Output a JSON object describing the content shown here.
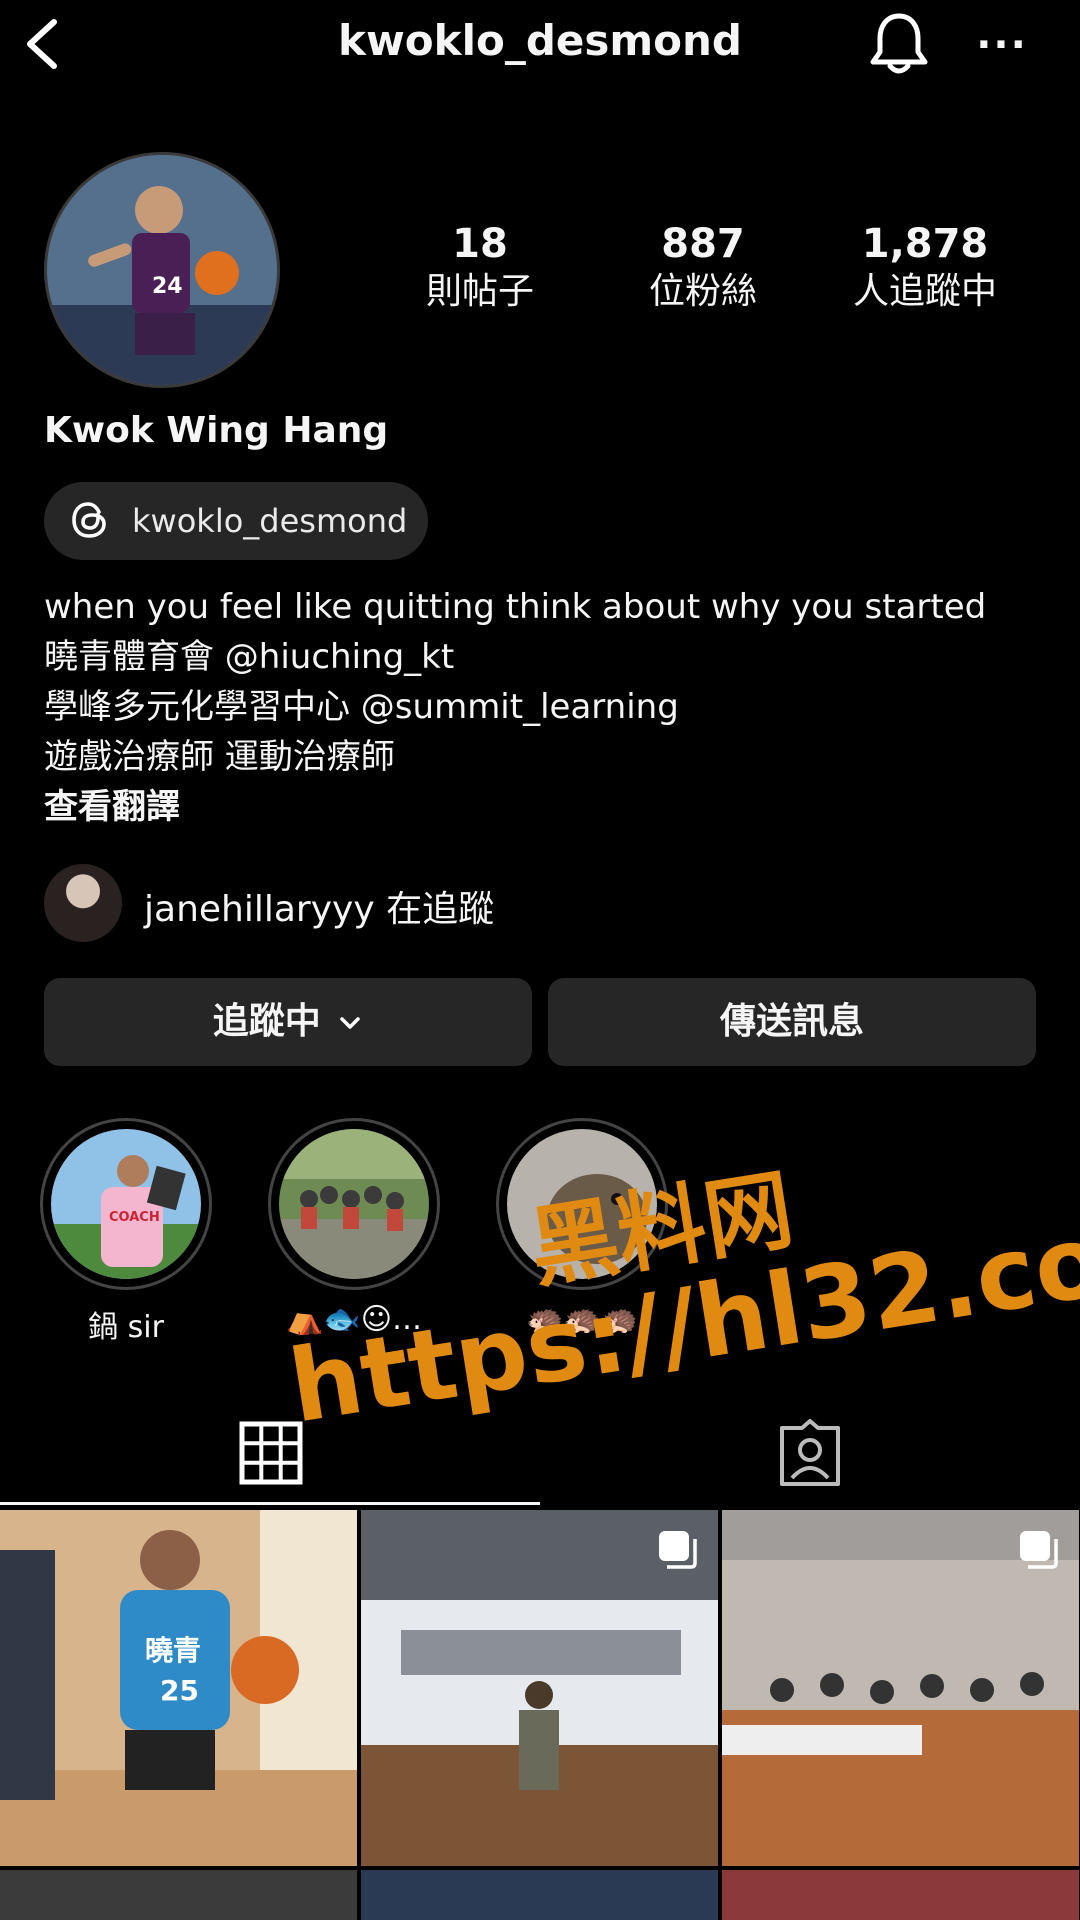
{
  "header": {
    "username": "kwoklo_desmond",
    "back_icon": "chevron-left-icon",
    "bell_icon": "bell-icon",
    "more_icon": "more-horizontal-icon",
    "more_glyph": "···"
  },
  "profile": {
    "stats": [
      {
        "value": "18",
        "label": "則帖子"
      },
      {
        "value": "887",
        "label": "位粉絲"
      },
      {
        "value": "1,878",
        "label": "人追蹤中"
      }
    ],
    "full_name": "Kwok Wing Hang",
    "threads_handle": "kwoklo_desmond",
    "bio_lines": [
      "when you feel like quitting think about why you started",
      "曉青體育會 @hiuching_kt",
      "學峰多元化學習中心 @summit_learning",
      "遊戲治療師 運動治療師"
    ],
    "translate_label": "查看翻譯",
    "followed_by": "janehillaryyy 在追蹤"
  },
  "actions": {
    "following_label": "追蹤中",
    "message_label": "傳送訊息"
  },
  "highlights": [
    {
      "label": "鍋 sir"
    },
    {
      "label": "⛺🐟☺…"
    },
    {
      "label": "🦔🦔🦔"
    }
  ],
  "watermark": {
    "line1": "黑料网",
    "line2": "https://hl32.co"
  },
  "colors": {
    "background": "#000000",
    "button_bg": "#262626",
    "watermark": "#e08a12"
  }
}
